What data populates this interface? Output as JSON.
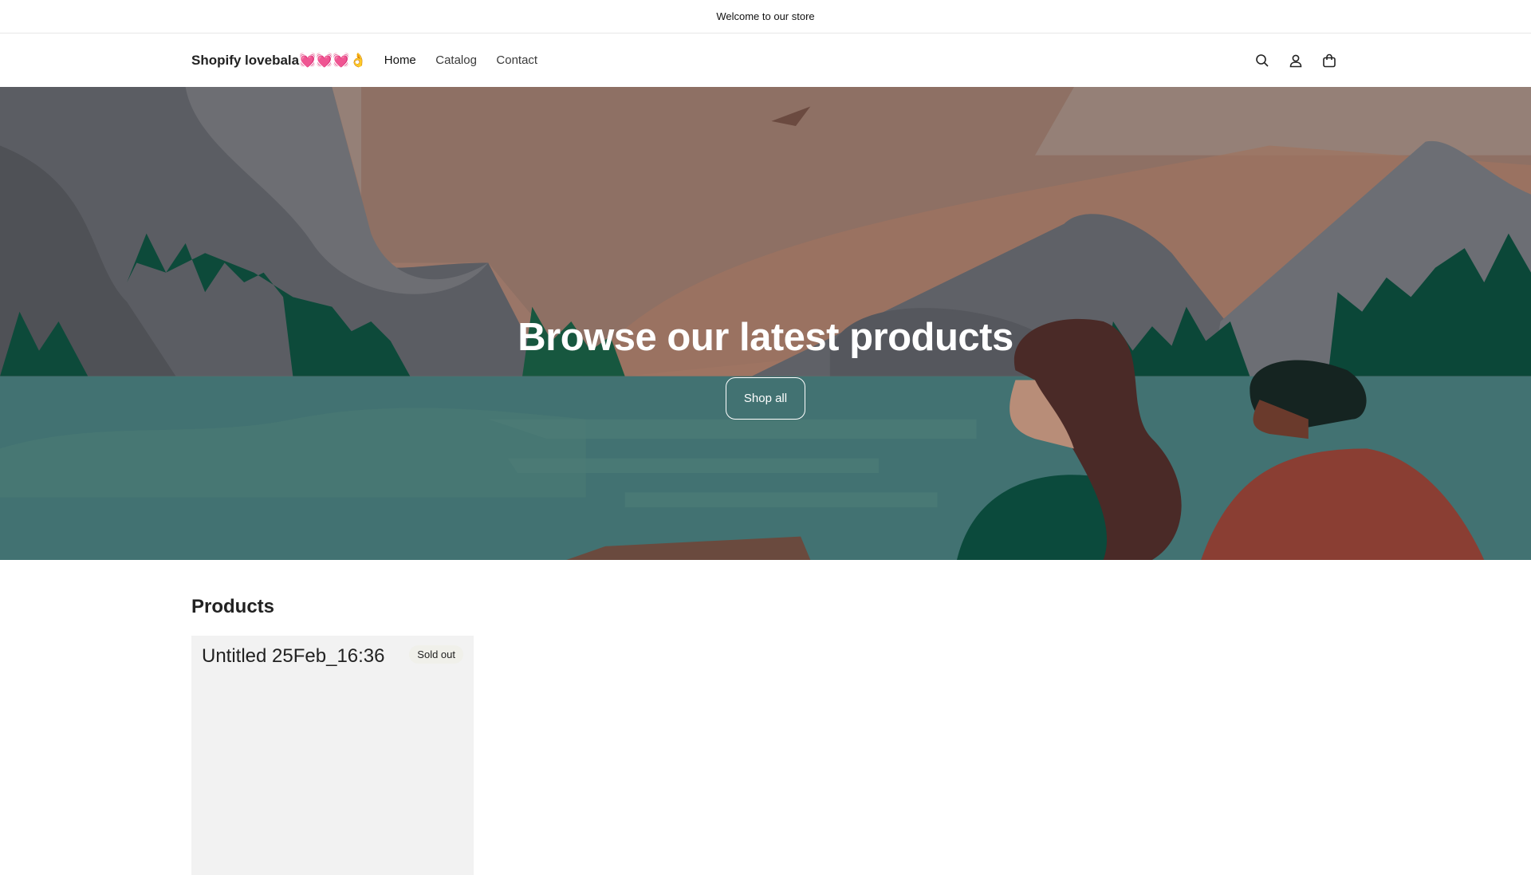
{
  "announcement": "Welcome to our store",
  "header": {
    "logo": "Shopify lovebala💓💓💓👌",
    "nav": [
      "Home",
      "Catalog",
      "Contact"
    ]
  },
  "hero": {
    "heading": "Browse our latest products",
    "button": "Shop all"
  },
  "products": {
    "title": "Products",
    "items": [
      {
        "title": "Untitled 25Feb_16:36",
        "badge": "Sold out"
      }
    ]
  }
}
